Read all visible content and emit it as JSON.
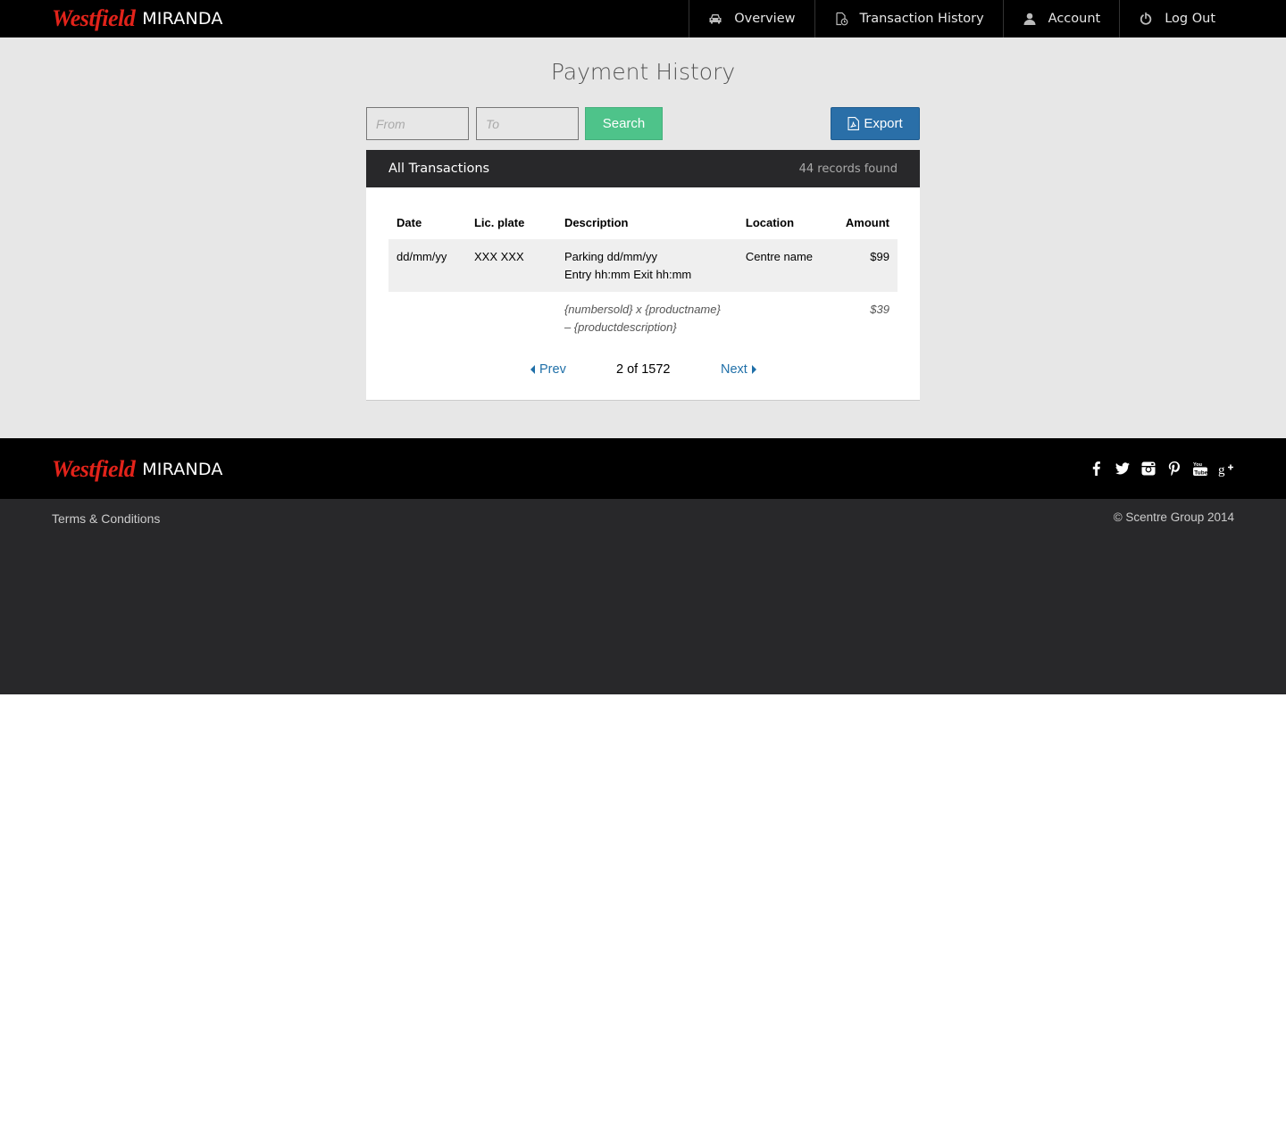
{
  "header": {
    "brand": "Westfield",
    "centre": "MIRANDA",
    "nav": [
      {
        "label": "Overview",
        "icon": "car-icon"
      },
      {
        "label": "Transaction History",
        "icon": "document-clock-icon"
      },
      {
        "label": "Account",
        "icon": "user-icon"
      },
      {
        "label": "Log Out",
        "icon": "power-icon"
      }
    ]
  },
  "main": {
    "title": "Payment History",
    "from_placeholder": "From",
    "to_placeholder": "To",
    "search_label": "Search",
    "export_label": "Export",
    "panel": {
      "title": "All Transactions",
      "count": "44 records found"
    },
    "table": {
      "headers": [
        "Date",
        "Lic. plate",
        "Description",
        "Location",
        "Amount"
      ],
      "row": {
        "date": "dd/mm/yy",
        "plate": "XXX XXX",
        "desc_line1": "Parking dd/mm/yy",
        "desc_line2": "Entry hh:mm Exit hh:mm",
        "location": "Centre name",
        "amount": "$99"
      },
      "sub_row": {
        "desc_line1": "{numbersold} x {productname}",
        "desc_line2": "– {productdescription}",
        "amount": "$39"
      }
    },
    "pager": {
      "prev": "Prev",
      "position": "2 of 1572",
      "next": "Next"
    }
  },
  "footer": {
    "brand": "Westfield",
    "centre": "MIRANDA",
    "social": [
      "facebook-icon",
      "twitter-icon",
      "instagram-icon",
      "pinterest-icon",
      "youtube-icon",
      "google-plus-icon"
    ],
    "terms": "Terms & Conditions",
    "copyright": "© Scentre Group 2014"
  },
  "colors": {
    "brand_red": "#e2231a",
    "search_green": "#4ec38a",
    "export_blue": "#2a6fa8",
    "link_blue": "#1f6fa8"
  }
}
